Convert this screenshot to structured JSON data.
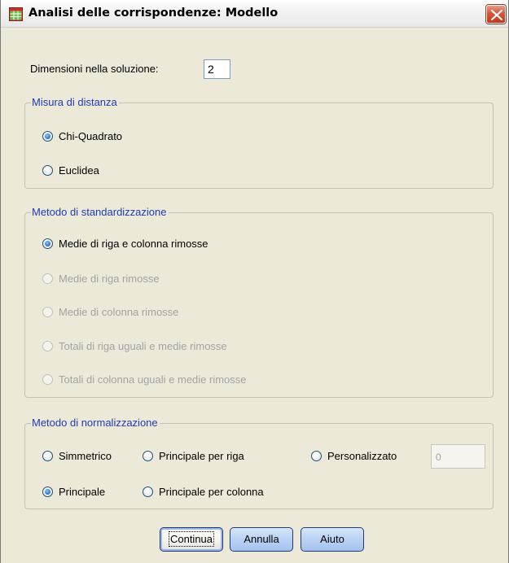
{
  "window": {
    "title": "Analisi delle corrispondenze: Modello",
    "close_label": "×"
  },
  "dimensions": {
    "label": "Dimensioni nella soluzione:",
    "value": "2"
  },
  "distance": {
    "legend": "Misura di distanza",
    "options": [
      {
        "label": "Chi-Quadrato",
        "checked": true,
        "enabled": true
      },
      {
        "label": "Euclidea",
        "checked": false,
        "enabled": true
      }
    ]
  },
  "standardization": {
    "legend": "Metodo di standardizzazione",
    "options": [
      {
        "label": "Medie di riga e colonna rimosse",
        "checked": true,
        "enabled": true
      },
      {
        "label": "Medie di riga rimosse",
        "checked": false,
        "enabled": false
      },
      {
        "label": "Medie di colonna rimosse",
        "checked": false,
        "enabled": false
      },
      {
        "label": "Totali di riga uguali e medie rimosse",
        "checked": false,
        "enabled": false
      },
      {
        "label": "Totali di colonna uguali e medie rimosse",
        "checked": false,
        "enabled": false
      }
    ]
  },
  "normalization": {
    "legend": "Metodo di normalizzazione",
    "options": [
      {
        "label": "Simmetrico",
        "checked": false,
        "enabled": true
      },
      {
        "label": "Principale per riga",
        "checked": false,
        "enabled": true
      },
      {
        "label": "Personalizzato",
        "checked": false,
        "enabled": true
      },
      {
        "label": "Principale",
        "checked": true,
        "enabled": true
      },
      {
        "label": "Principale per colonna",
        "checked": false,
        "enabled": true
      }
    ],
    "custom_value": "0"
  },
  "buttons": {
    "continue": "Continua",
    "cancel": "Annulla",
    "help": "Aiuto"
  },
  "colors": {
    "group_legend": "#1f3bb8",
    "dialog_background": "#ece9d8",
    "radio_checked": "#2db02d"
  }
}
